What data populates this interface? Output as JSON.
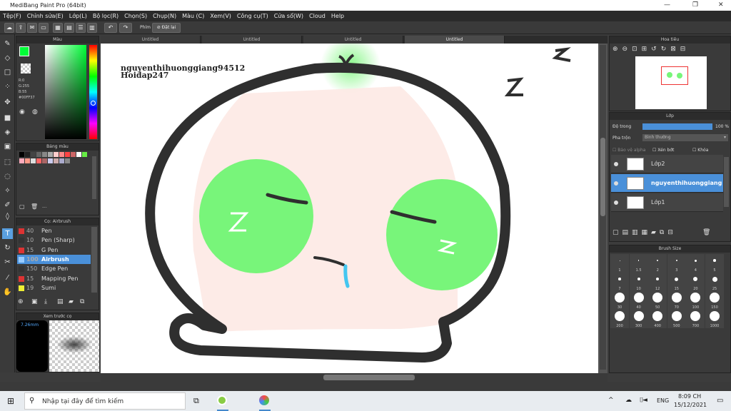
{
  "window": {
    "title": "MediBang Paint Pro (64bit)"
  },
  "menu": [
    "Tệp(F)",
    "Chỉnh sửa(E)",
    "Lớp(L)",
    "Bộ lọc(R)",
    "Chọn(S)",
    "Chụp(N)",
    "Màu (C)",
    "Xem(V)",
    "Công cụ(T)",
    "Cửa sổ(W)",
    "Cloud",
    "Help"
  ],
  "toolbar": {
    "key_label": "Phím",
    "reset_label": "Đặt lại"
  },
  "color_panel": {
    "title": "Màu",
    "r": "R:0",
    "g": "G:255",
    "b": "B:55",
    "hex": "#00FF37",
    "fg": "#00ff37"
  },
  "palette_panel": {
    "title": "Bảng màu",
    "status": "---"
  },
  "brush_panel": {
    "title": "Cọ: Airbrush",
    "items": [
      {
        "size": "40",
        "name": "Pen",
        "color": "#d33"
      },
      {
        "size": "10",
        "name": "Pen (Sharp)",
        "color": "#333"
      },
      {
        "size": "15",
        "name": "G Pen",
        "color": "#d33"
      },
      {
        "size": "100",
        "name": "Airbrush",
        "color": "#9cf"
      },
      {
        "size": "150",
        "name": "Edge Pen",
        "color": "#333"
      },
      {
        "size": "15",
        "name": "Mapping Pen",
        "color": "#d33"
      },
      {
        "size": "19",
        "name": "Sumi",
        "color": "#ee3"
      }
    ]
  },
  "preview_panel": {
    "title": "Xem trước cọ",
    "size": "7.26mm"
  },
  "tabs": [
    "Untitled",
    "Untitled",
    "Untitled",
    "Untitled"
  ],
  "canvas": {
    "watermark_line1": "nguyenthihuonggiang94512",
    "watermark_line2": "Hoidap247"
  },
  "navigator": {
    "title": "Hoa tiêu"
  },
  "layers_panel": {
    "title": "Lớp",
    "opacity_label": "Độ trong",
    "opacity_value": "100 %",
    "opacity_fill": 1.0,
    "blend_label": "Pha trộn",
    "blend_value": "Bình thường",
    "protect_alpha": "Bảo vệ alpha",
    "clipping": "Xén bớt",
    "lock": "Khóa",
    "layers": [
      {
        "name": "Lớp2"
      },
      {
        "name": "nguyenthihuonggiang"
      },
      {
        "name": "Lớp1"
      }
    ]
  },
  "brush_size_panel": {
    "title": "Brush Size",
    "sizes": [
      "1",
      "1.5",
      "2",
      "3",
      "4",
      "5",
      "7",
      "10",
      "12",
      "15",
      "20",
      "25",
      "30",
      "40",
      "50",
      "70",
      "100",
      "150",
      "200",
      "300",
      "400",
      "500",
      "700",
      "1000"
    ]
  },
  "taskbar": {
    "search_placeholder": "Nhập tại đây để tìm kiếm",
    "lang": "ENG",
    "time": "8:09 CH",
    "date": "15/12/2021"
  }
}
